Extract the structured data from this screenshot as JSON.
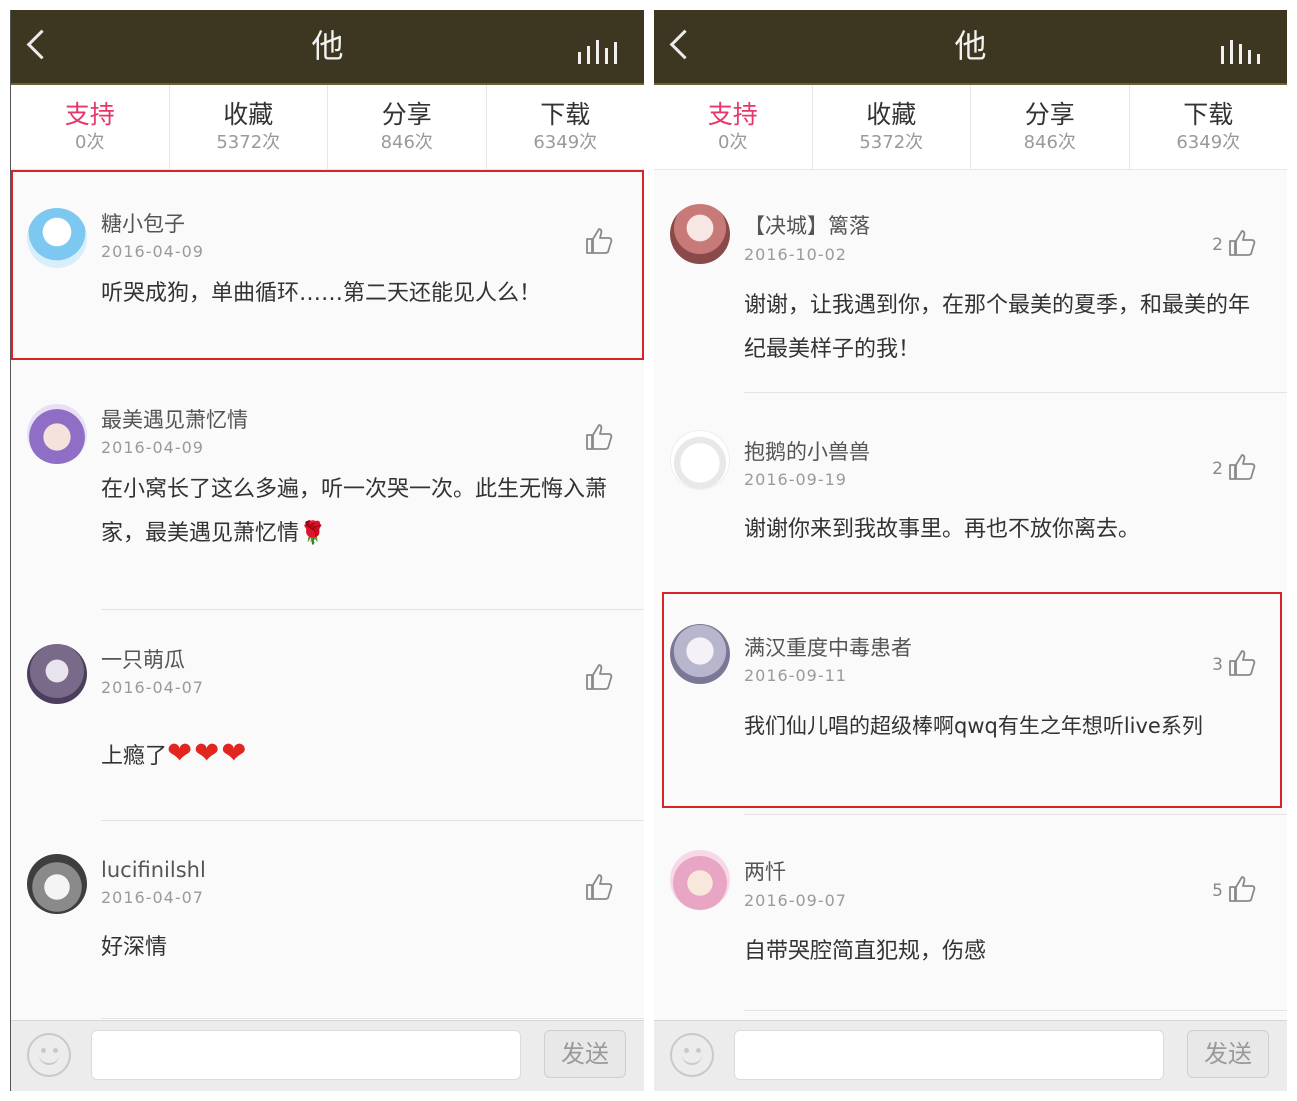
{
  "left": {
    "title": "他",
    "stats": [
      {
        "label": "支持",
        "count": "0次"
      },
      {
        "label": "收藏",
        "count": "5372次"
      },
      {
        "label": "分享",
        "count": "846次"
      },
      {
        "label": "下载",
        "count": "6349次"
      }
    ],
    "comments": [
      {
        "name": "糖小包子",
        "date": "2016-04-09",
        "text": "听哭成狗，单曲循环……第二天还能见人么！",
        "likes": ""
      },
      {
        "name": "最美遇见萧忆情",
        "date": "2016-04-09",
        "text": "在小窝长了这么多遍，听一次哭一次。此生无悔入萧家，最美遇见萧忆情",
        "emoji": "🌹",
        "likes": ""
      },
      {
        "name": "一只萌瓜",
        "date": "2016-04-07",
        "text": "上瘾了",
        "emoji": "❤❤❤",
        "likes": ""
      },
      {
        "name": "lucifinilshl",
        "date": "2016-04-07",
        "text": "好深情",
        "likes": ""
      }
    ],
    "send_label": "发送"
  },
  "right": {
    "title": "他",
    "stats": [
      {
        "label": "支持",
        "count": "0次"
      },
      {
        "label": "收藏",
        "count": "5372次"
      },
      {
        "label": "分享",
        "count": "846次"
      },
      {
        "label": "下载",
        "count": "6349次"
      }
    ],
    "comments": [
      {
        "name": "【决城】篱落",
        "date": "2016-10-02",
        "text": "谢谢，让我遇到你，在那个最美的夏季，和最美的年纪最美样子的我！",
        "likes": "2"
      },
      {
        "name": "抱鹅的小兽兽",
        "date": "2016-09-19",
        "text": "谢谢你来到我故事里。再也不放你离去。",
        "likes": "2"
      },
      {
        "name": "满汉重度中毒患者",
        "date": "2016-09-11",
        "text": "我们仙儿唱的超级棒啊qwq有生之年想听live系列",
        "likes": "3"
      },
      {
        "name": "两忏",
        "date": "2016-09-07",
        "text": "自带哭腔简直犯规，伤感",
        "likes": "5"
      }
    ],
    "send_label": "发送"
  },
  "colors": {
    "titlebar": "#3d3721",
    "accent": "#e8366a",
    "highlight": "#d8232a"
  },
  "icons": [
    "back-arrow-icon",
    "equalizer-icon",
    "thumbs-up-icon",
    "emoji-icon"
  ]
}
